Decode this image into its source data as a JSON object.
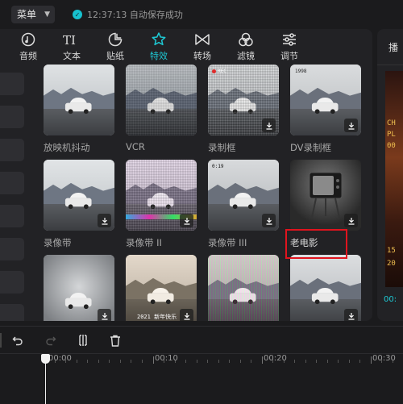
{
  "topbar": {
    "menu_label": "菜单",
    "save_status": "12:37:13 自动保存成功"
  },
  "tabs": [
    {
      "label": "音频",
      "icon": "music-icon"
    },
    {
      "label": "文本",
      "icon": "text-icon"
    },
    {
      "label": "贴纸",
      "icon": "sticker-icon"
    },
    {
      "label": "特效",
      "icon": "effects-star-icon",
      "active": true
    },
    {
      "label": "转场",
      "icon": "transition-icon"
    },
    {
      "label": "滤镜",
      "icon": "filter-icon"
    },
    {
      "label": "调节",
      "icon": "adjust-icon"
    }
  ],
  "effects": [
    {
      "label": "放映机抖动"
    },
    {
      "label": "VCR"
    },
    {
      "label": "录制框",
      "hud": "REC"
    },
    {
      "label": "DV录制框",
      "hud": "1998"
    },
    {
      "label": "录像带"
    },
    {
      "label": "录像带 II"
    },
    {
      "label": "录像带 III",
      "hud": "0:19"
    },
    {
      "label": "老电影",
      "highlighted": true
    },
    {
      "label": ""
    },
    {
      "label": "",
      "hud": "2021 新年快乐"
    },
    {
      "label": ""
    },
    {
      "label": ""
    }
  ],
  "preview": {
    "title": "播",
    "text_lines": [
      "CH",
      "PL",
      "00",
      "15",
      "20"
    ],
    "time": "00:"
  },
  "timeline": {
    "ticks": [
      "00:00",
      "00:10",
      "00:20",
      "00:30"
    ]
  },
  "colors": {
    "accent": "#1ec9d4",
    "highlight_box": "#e0141e",
    "panel_bg": "#222225",
    "app_bg": "#1b1b1d"
  }
}
